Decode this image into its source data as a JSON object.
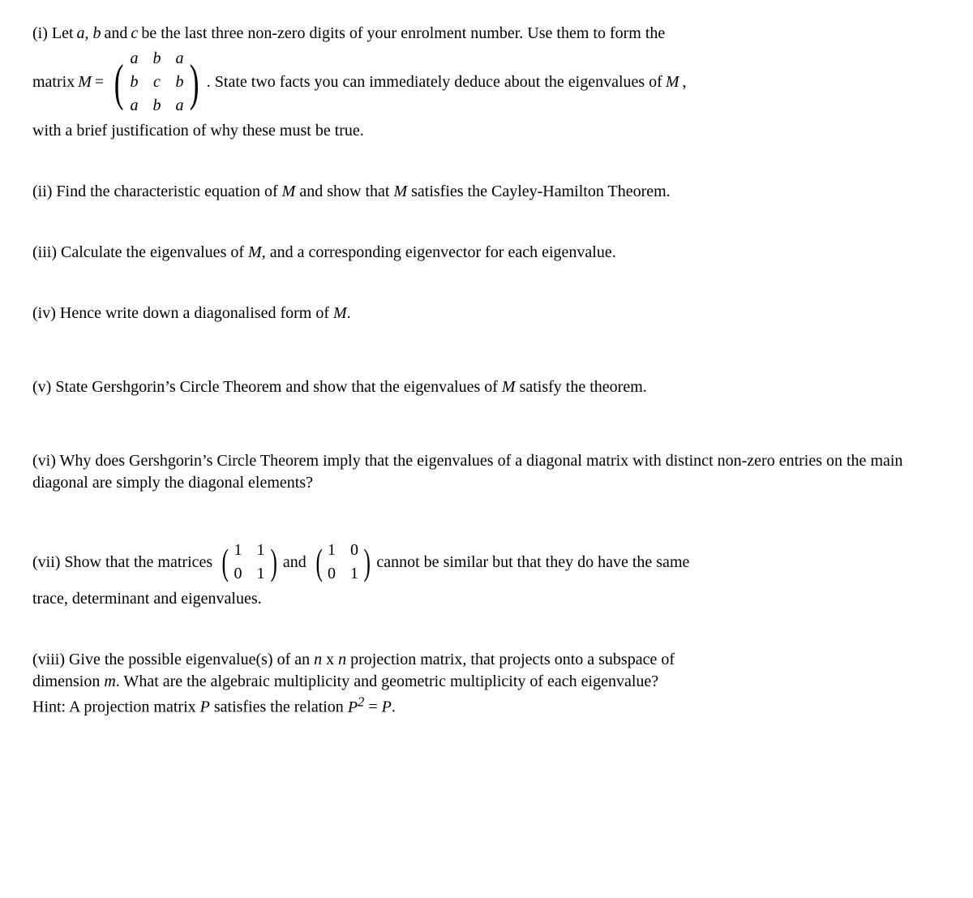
{
  "q1": {
    "pre": "(i) Let ",
    "a": "a, b",
    "mid1": " and ",
    "c": "c",
    "mid2": " be the last three non-zero digits of your enrolment number. Use them to form the",
    "matrix_pre": "matrix ",
    "M": "M",
    "eq": " = ",
    "m": [
      [
        "a",
        "b",
        "a"
      ],
      [
        "b",
        "c",
        "b"
      ],
      [
        "a",
        "b",
        "a"
      ]
    ],
    "post1": ". State two facts you can immediately deduce about the eigenvalues of ",
    "post1b": ",",
    "post2": "with a brief justification of why these must be true."
  },
  "q2": {
    "t": "(ii) Find the characteristic equation of ",
    "M": "M",
    "mid": " and show that ",
    "end": " satisfies the Cayley-Hamilton Theorem."
  },
  "q3": {
    "t": "(iii) Calculate the eigenvalues of ",
    "M": "M",
    "end": ", and a corresponding eigenvector for each eigenvalue."
  },
  "q4": {
    "t": "(iv) Hence write down a diagonalised form of ",
    "M": "M",
    "end": "."
  },
  "q5": {
    "t": "(v) State Gershgorin’s Circle Theorem and show that the eigenvalues of ",
    "M": "M",
    "end": " satisfy the theorem."
  },
  "q6": {
    "t": "(vi) Why does Gershgorin’s Circle Theorem imply that the eigenvalues of a diagonal matrix with distinct non-zero entries on the main diagonal are simply the diagonal elements?"
  },
  "q7": {
    "pre": "(vii) Show that the matrices ",
    "mA": [
      [
        "1",
        "1"
      ],
      [
        "0",
        "1"
      ]
    ],
    "and": " and ",
    "mB": [
      [
        "1",
        "0"
      ],
      [
        "0",
        "1"
      ]
    ],
    "post": " cannot be similar but that they do have the same",
    "line2": "trace, determinant and eigenvalues."
  },
  "q8": {
    "l1a": "(viii) Give the possible eigenvalue(s) of an ",
    "n": "n",
    "x": " x ",
    "l1b": " projection matrix, that projects onto a subspace of",
    "l2a": "dimension ",
    "m": "m",
    "l2b": ". What are the algebraic multiplicity and geometric multiplicity of each eigenvalue?",
    "l3a": "Hint: A projection matrix ",
    "P": "P",
    "l3b": " satisfies the relation ",
    "P2": "P",
    "sq": "2",
    "eq": " = ",
    "dot": "."
  }
}
